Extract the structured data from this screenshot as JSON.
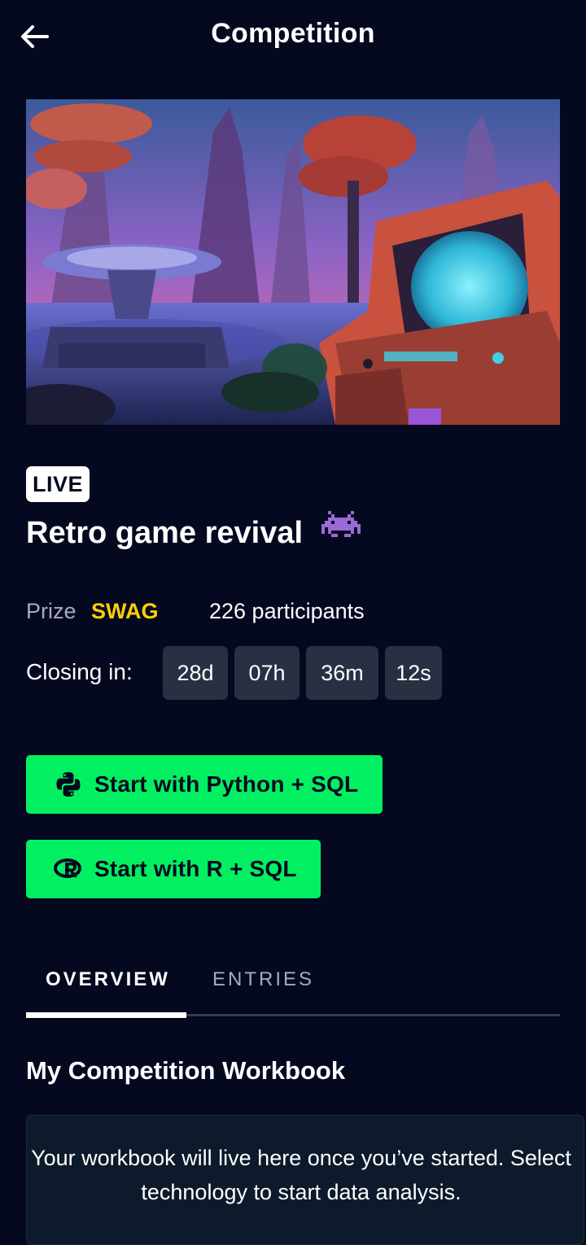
{
  "header": {
    "title": "Competition",
    "back_icon": "arrow-left-icon"
  },
  "hero": {
    "image": "retro arcade cabinet in alien landscape illustration",
    "colors": {
      "sky_top": "#3b5a9a",
      "sky_bottom": "#b05ac8",
      "ground": "#2a1f45",
      "arcade": "#c8523e",
      "screen": "#3fd0e6"
    }
  },
  "competition": {
    "status_badge": "LIVE",
    "title": "Retro game revival",
    "title_emoji_icon": "alien-monster-icon",
    "prize_label": "Prize",
    "prize_value": "SWAG",
    "participants": "226 participants",
    "closing_label": "Closing in:",
    "countdown": {
      "days": "28d",
      "hours": "07h",
      "minutes": "36m",
      "seconds": "12s"
    }
  },
  "actions": {
    "python_button": {
      "label": "Start with Python + SQL",
      "icon": "python-icon"
    },
    "r_button": {
      "label": "Start with R + SQL",
      "icon": "r-language-icon"
    }
  },
  "tabs": {
    "items": [
      {
        "label": "OVERVIEW",
        "active": true
      },
      {
        "label": "ENTRIES",
        "active": false
      }
    ]
  },
  "workbook": {
    "section_title": "My Competition Workbook",
    "empty_message": "Your workbook will live here once you’ve started. Select technology to start data analysis."
  },
  "theme": {
    "background": "#05091f",
    "accent_green": "#03ef62",
    "prize_yellow": "#fcce0d",
    "chip_bg": "#273142"
  }
}
